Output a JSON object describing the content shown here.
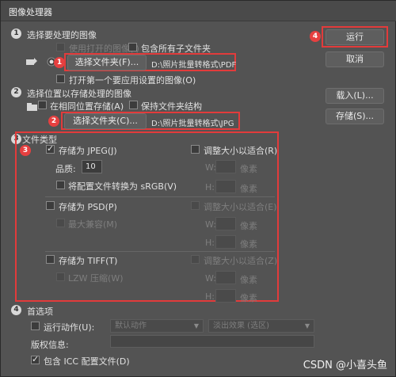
{
  "window": {
    "title": "图像处理器"
  },
  "section1": {
    "number": "1",
    "title": "选择要处理的图像",
    "use_open_images": "使用打开的图像(I)",
    "include_subfolders": "包含所有子文件夹",
    "select_folder_button": "选择文件夹(F)...",
    "path": "D:\\照片批量转格式\\PDF",
    "open_first": "打开第一个要应用设置的图像(O)",
    "annotation": "1"
  },
  "section2": {
    "number": "2",
    "title": "选择位置以存储处理的图像",
    "save_same_location": "在相同位置存储(A)",
    "keep_folder_structure": "保持文件夹结构",
    "select_folder_button": "选择文件夹(C)...",
    "path": "D:\\照片批量转格式\\JPG",
    "annotation": "2"
  },
  "section3": {
    "number": "3",
    "title": "文件类型",
    "annotation": "3",
    "jpeg": {
      "label": "存储为 JPEG(J)",
      "checked": true,
      "resize_label": "调整大小以适合(R)",
      "quality_label": "品质:",
      "quality_value": "10",
      "w_label": "W:",
      "h_label": "H:",
      "unit": "像素",
      "convert_srgb": "将配置文件转换为 sRGB(V)"
    },
    "psd": {
      "label": "存储为 PSD(P)",
      "resize_label": "调整大小以适合(E)",
      "max_compat": "最大兼容(M)",
      "w_label": "W:",
      "h_label": "H:",
      "unit": "像素"
    },
    "tiff": {
      "label": "存储为 TIFF(T)",
      "resize_label": "调整大小以适合(Z)",
      "lzw": "LZW 压缩(W)",
      "w_label": "W:",
      "h_label": "H:",
      "unit": "像素"
    }
  },
  "section4": {
    "number": "4",
    "title": "首选项",
    "run_action": "运行动作(U):",
    "action_set": "默认动作",
    "action_name": "淡出效果 (选区)",
    "copyright_label": "版权信息:",
    "include_icc": "包含 ICC 配置文件(D)"
  },
  "buttons": {
    "run": "运行",
    "cancel": "取消",
    "load": "载入(L)...",
    "save": "存储(S)...",
    "run_annotation": "4"
  },
  "watermark": "CSDN @小喜头鱼",
  "colors": {
    "annotation_red": "#e23b3b",
    "background": "#535353"
  }
}
